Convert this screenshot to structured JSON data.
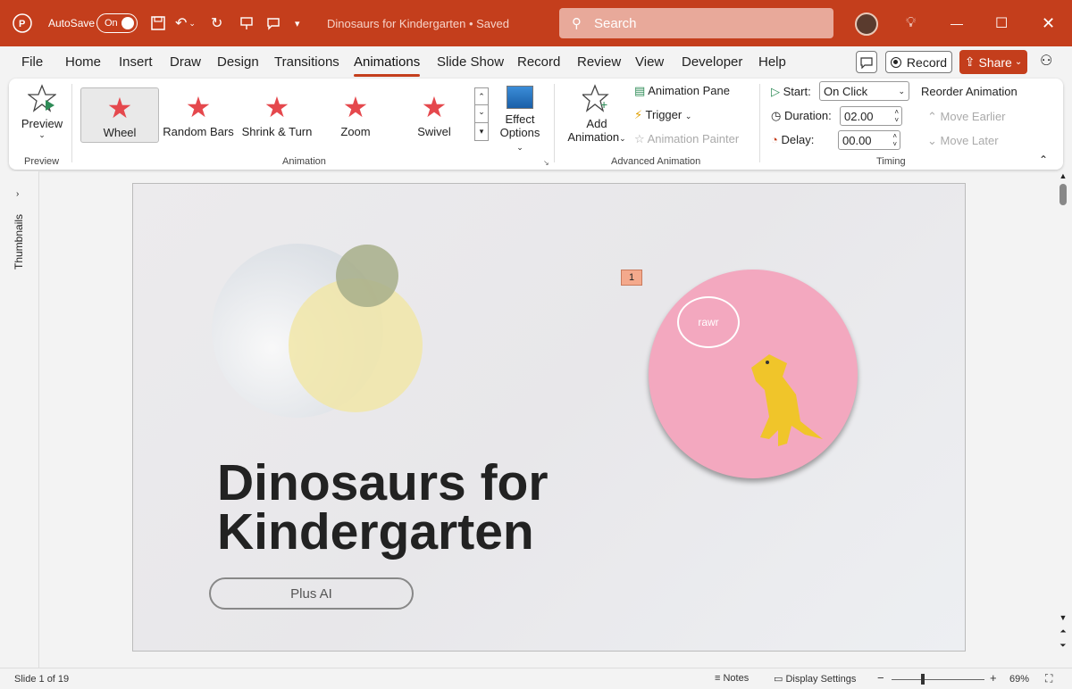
{
  "titlebar": {
    "autosave_label": "AutoSave",
    "autosave_state": "On",
    "doc_title": "Dinosaurs for Kindergarten • Saved",
    "search_placeholder": "Search"
  },
  "menu": {
    "tabs": [
      "File",
      "Home",
      "Insert",
      "Draw",
      "Design",
      "Transitions",
      "Animations",
      "Slide Show",
      "Record",
      "Review",
      "View",
      "Developer",
      "Help"
    ],
    "active_tab": "Animations",
    "record_label": "Record",
    "share_label": "Share"
  },
  "ribbon": {
    "preview": {
      "label": "Preview",
      "group": "Preview"
    },
    "animation_gallery": {
      "items": [
        "Wheel",
        "Random Bars",
        "Shrink & Turn",
        "Zoom",
        "Swivel"
      ],
      "selected": "Wheel",
      "group": "Animation"
    },
    "effect_options": {
      "line1": "Effect",
      "line2": "Options"
    },
    "advanced": {
      "add_line1": "Add",
      "add_line2": "Animation",
      "pane": "Animation Pane",
      "trigger": "Trigger",
      "painter": "Animation Painter",
      "group": "Advanced Animation"
    },
    "timing": {
      "start_label": "Start:",
      "start_value": "On Click",
      "duration_label": "Duration:",
      "duration_value": "02.00",
      "delay_label": "Delay:",
      "delay_value": "00.00",
      "reorder": "Reorder Animation",
      "move_earlier": "Move Earlier",
      "move_later": "Move Later",
      "group": "Timing"
    }
  },
  "leftpane": {
    "label": "Thumbnails"
  },
  "slide": {
    "title_line1": "Dinosaurs for",
    "title_line2": "Kindergarten",
    "button_label": "Plus AI",
    "animation_tag": "1",
    "bubble_text": "rawr"
  },
  "status": {
    "slide_info": "Slide 1 of 19",
    "notes": "Notes",
    "display_settings": "Display Settings",
    "zoom": "69%"
  },
  "colors": {
    "accent": "#c43e1c",
    "anim_star": "#e5484d"
  }
}
